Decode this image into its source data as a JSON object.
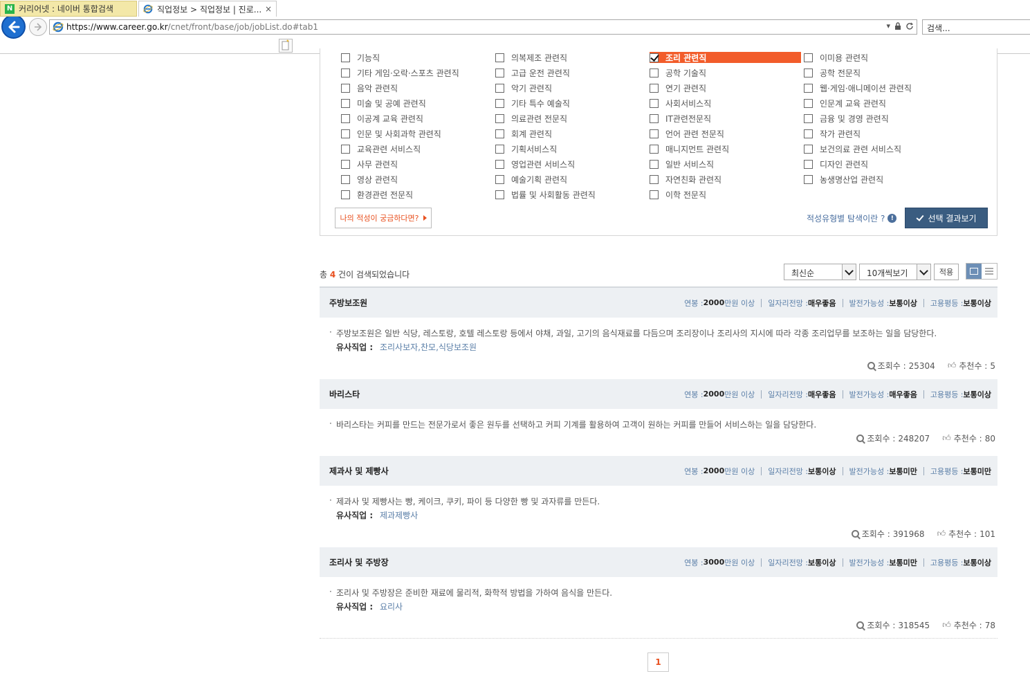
{
  "browser": {
    "url_host": "https://www.career.go.kr",
    "url_path": "/cnet/front/base/job/jobList.do#tab1",
    "search_placeholder": "검색...",
    "tabs": [
      {
        "label": "커리어넷 : 네이버 통합검색"
      },
      {
        "label": "직업정보 > 직업정보 | 진로...",
        "close": "×"
      }
    ]
  },
  "filters": {
    "items": [
      {
        "label": "기능직",
        "checked": false
      },
      {
        "label": "의복제조 관련직",
        "checked": false
      },
      {
        "label": "조리 관련직",
        "checked": true
      },
      {
        "label": "이미용 관련직",
        "checked": false
      },
      {
        "label": "기타 게임·오락·스포츠 관련직",
        "checked": false
      },
      {
        "label": "고급 운전 관련직",
        "checked": false
      },
      {
        "label": "공학 기술직",
        "checked": false
      },
      {
        "label": "공학 전문직",
        "checked": false
      },
      {
        "label": "음악 관련직",
        "checked": false
      },
      {
        "label": "악기 관련직",
        "checked": false
      },
      {
        "label": "연기 관련직",
        "checked": false
      },
      {
        "label": "웹·게임·애니메이션 관련직",
        "checked": false
      },
      {
        "label": "미술 및 공예 관련직",
        "checked": false
      },
      {
        "label": "기타 특수 예술직",
        "checked": false
      },
      {
        "label": "사회서비스직",
        "checked": false
      },
      {
        "label": "인문계 교육 관련직",
        "checked": false
      },
      {
        "label": "이공계 교육 관련직",
        "checked": false
      },
      {
        "label": "의료관련 전문직",
        "checked": false
      },
      {
        "label": "IT관련전문직",
        "checked": false
      },
      {
        "label": "금융 및 경영 관련직",
        "checked": false
      },
      {
        "label": "인문 및 사회과학 관련직",
        "checked": false
      },
      {
        "label": "회계 관련직",
        "checked": false
      },
      {
        "label": "언어 관련 전문직",
        "checked": false
      },
      {
        "label": "작가 관련직",
        "checked": false
      },
      {
        "label": "교육관련 서비스직",
        "checked": false
      },
      {
        "label": "기획서비스직",
        "checked": false
      },
      {
        "label": "매니지먼트 관련직",
        "checked": false
      },
      {
        "label": "보건의료 관련 서비스직",
        "checked": false
      },
      {
        "label": "사무 관련직",
        "checked": false
      },
      {
        "label": "영업관련 서비스직",
        "checked": false
      },
      {
        "label": "일반 서비스직",
        "checked": false
      },
      {
        "label": "디자인 관련직",
        "checked": false
      },
      {
        "label": "영상 관련직",
        "checked": false
      },
      {
        "label": "예술기획 관련직",
        "checked": false
      },
      {
        "label": "자연친화 관련직",
        "checked": false
      },
      {
        "label": "농생명산업 관련직",
        "checked": false
      },
      {
        "label": "환경관련 전문직",
        "checked": false
      },
      {
        "label": "법률 및 사회활동 관련직",
        "checked": false
      },
      {
        "label": "이학 전문직",
        "checked": false
      }
    ],
    "aptitude_button": "나의 적성이 궁금하다면?",
    "aptitude_link": "적성유형별 탐색이란 ?",
    "select_result_button": "선택 결과보기"
  },
  "results": {
    "count_prefix": "총 ",
    "count": "4",
    "count_suffix": " 건이 검색되었습니다",
    "sort_value": "최신순",
    "per_page_value": "10개씩보기",
    "apply_label": "적용"
  },
  "labels": {
    "salary_key": "연봉 : ",
    "salary_unit": " 만원 이상",
    "outlook_key": "일자리전망 : ",
    "growth_key": "발전가능성 : ",
    "equality_key": "고용평등 : ",
    "similar_key": "유사직업 :",
    "views_key": "조회수 : ",
    "likes_key": "추천수 : "
  },
  "jobs": [
    {
      "title": "주방보조원",
      "salary": "2000",
      "outlook": "매우좋음",
      "growth": "보통이상",
      "equality": "보통이상",
      "desc": "주방보조원은 일반 식당, 레스토랑, 호텔 레스토랑 등에서 야채, 과일, 고기의 음식재료를 다듬으며 조리장이나 조리사의 지시에 따라 각종 조리업무를 보조하는 일을 담당한다.",
      "similar": "조리사보자,찬모,식당보조원",
      "views": "25304",
      "likes": "5"
    },
    {
      "title": "바리스타",
      "salary": "2000",
      "outlook": "매우좋음",
      "growth": "매우좋음",
      "equality": "보통이상",
      "desc": "바리스타는 커피를 만드는 전문가로서 좋은 원두를 선택하고 커피 기계를 활용하여 고객이 원하는 커피를 만들어 서비스하는 일을 담당한다.",
      "similar": "",
      "views": "248207",
      "likes": "80"
    },
    {
      "title": "제과사 및 제빵사",
      "salary": "2000",
      "outlook": "보통이상",
      "growth": "보통미만",
      "equality": "보통미만",
      "desc": "제과사 및 제빵사는 빵, 케이크, 쿠키, 파이 등 다양한 빵 및 과자류를 만든다.",
      "similar": "제과제빵사",
      "views": "391968",
      "likes": "101"
    },
    {
      "title": "조리사 및 주방장",
      "salary": "3000",
      "outlook": "보통이상",
      "growth": "보통미만",
      "equality": "보통이상",
      "desc": "조리사 및 주방장은 준비한 재료에 물리적, 화학적 방법을 가하여 음식을 만든다.",
      "similar": "요리사",
      "views": "318545",
      "likes": "78"
    }
  ],
  "pagination": {
    "current": "1"
  }
}
